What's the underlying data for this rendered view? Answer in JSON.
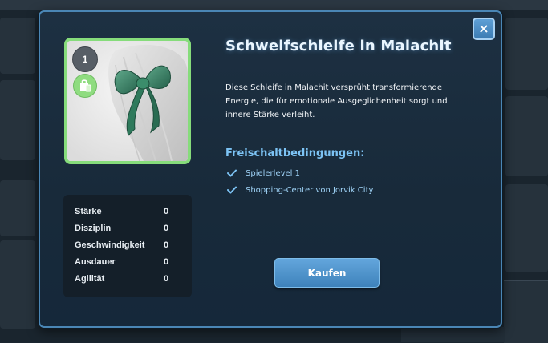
{
  "item": {
    "title": "Schweifschleife in Malachit",
    "description": "Diese Schleife in Malachit versprüht transformierende Energie, die für emotionale Ausgeglichenheit sorgt und innere Stärke verleiht.",
    "level": "1",
    "image_icon": "green-bow-on-horse-tail",
    "badge_icon": "shopping-bag-icon",
    "frame_color": "#86dc7b"
  },
  "stats": [
    {
      "name": "Stärke",
      "value": "0"
    },
    {
      "name": "Disziplin",
      "value": "0"
    },
    {
      "name": "Geschwindigkeit",
      "value": "0"
    },
    {
      "name": "Ausdauer",
      "value": "0"
    },
    {
      "name": "Agilität",
      "value": "0"
    }
  ],
  "conditions": {
    "title": "Freischaltbedingungen:",
    "items": [
      "Spielerlevel 1",
      "Shopping-Center von Jorvik City"
    ]
  },
  "buttons": {
    "buy_label": "Kaufen",
    "close_label": "×"
  },
  "colors": {
    "accent": "#4a86b5",
    "button": "#4f93cc",
    "condition_text": "#9fd3f7"
  }
}
